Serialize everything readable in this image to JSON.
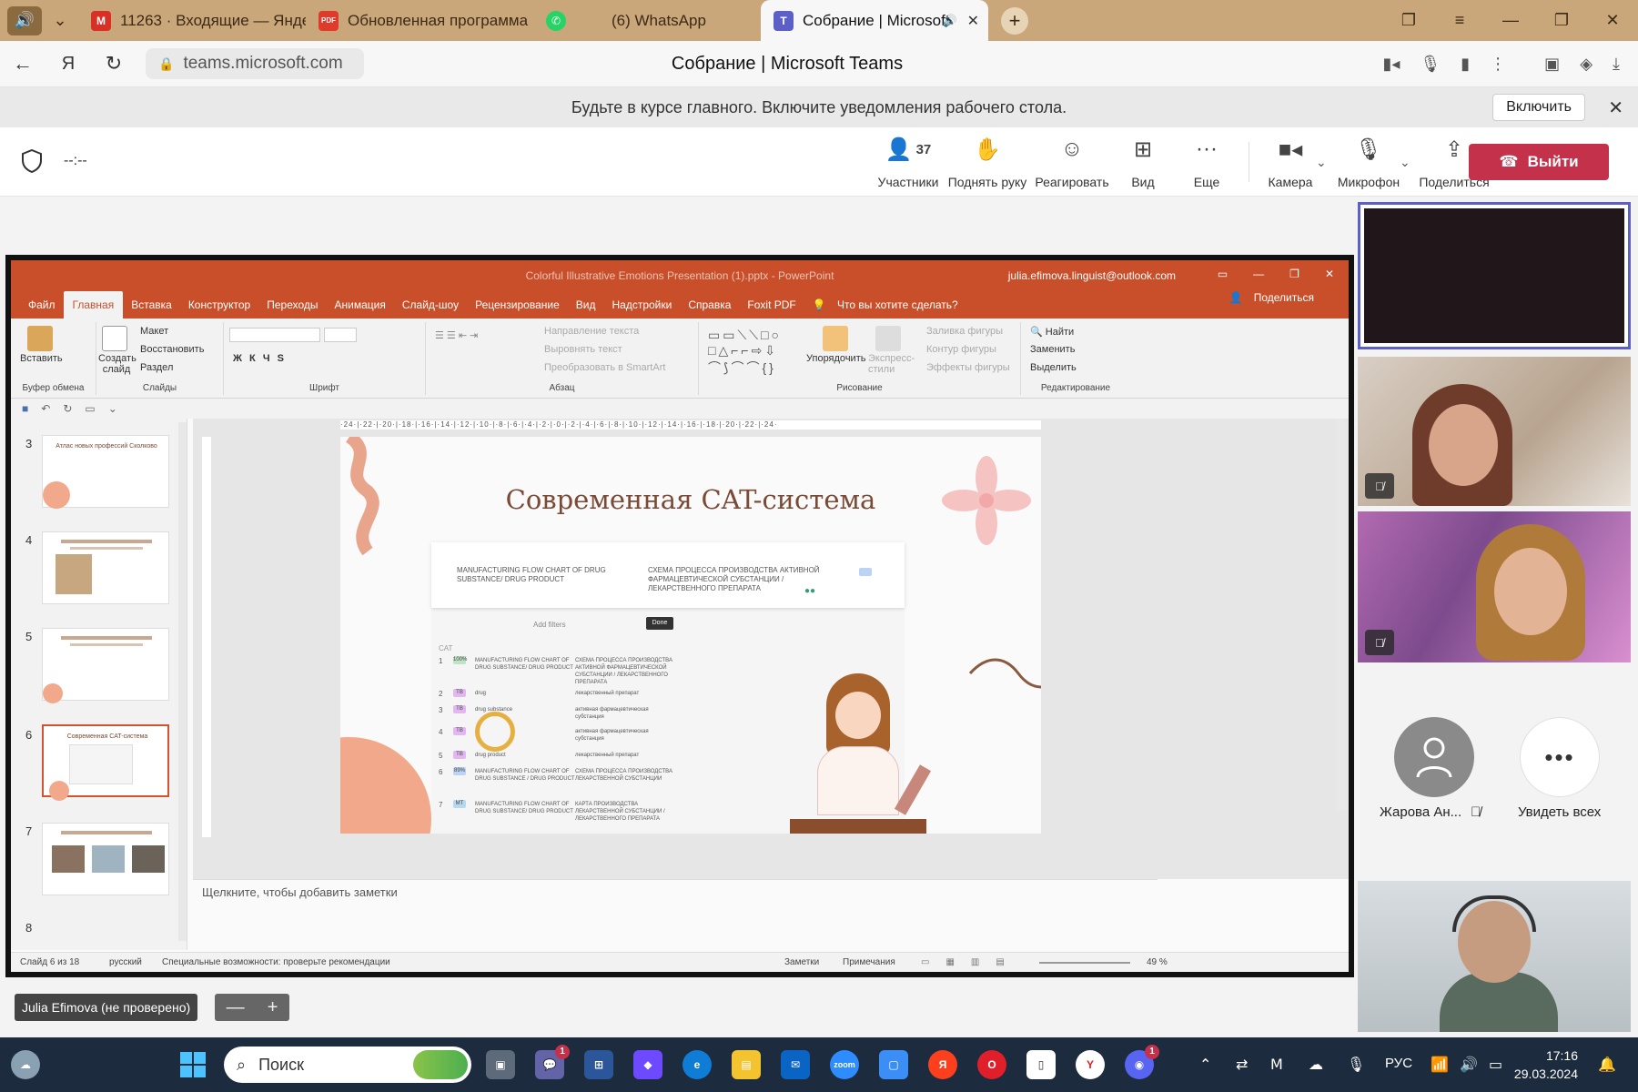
{
  "browser": {
    "tabs": [
      {
        "title": "11263 · Входящие — Янде",
        "icon": "mail-icon",
        "color": "#d93025"
      },
      {
        "title": "Обновленная программа",
        "icon": "pdf-icon",
        "color": "#e03a2b"
      },
      {
        "title": "(6) WhatsApp",
        "icon": "whatsapp-icon",
        "color": "#25d366"
      },
      {
        "title": "Собрание | Microsoft",
        "icon": "teams-icon",
        "color": "#5b5fc7",
        "active": true
      }
    ],
    "url": "teams.microsoft.com",
    "page_title": "Собрание | Microsoft Teams"
  },
  "notification": {
    "text": "Будьте в курсе главного. Включите уведомления рабочего стола.",
    "button": "Включить"
  },
  "meeting": {
    "timer": "--:--",
    "participants_count": "37",
    "tools": {
      "participants": "Участники",
      "raise_hand": "Поднять руку",
      "react": "Реагировать",
      "view": "Вид",
      "more": "Еще",
      "camera": "Камера",
      "mic": "Микрофон",
      "share": "Поделиться"
    },
    "leave": "Выйти",
    "presenter_name": "Julia Efimova (не проверено)"
  },
  "powerpoint": {
    "title": "Colorful Illustrative Emotions Presentation (1).pptx  -  PowerPoint",
    "account": "julia.efimova.linguist@outlook.com",
    "menu": [
      "Файл",
      "Главная",
      "Вставка",
      "Конструктор",
      "Переходы",
      "Анимация",
      "Слайд-шоу",
      "Рецензирование",
      "Вид",
      "Надстройки",
      "Справка",
      "Foxit PDF",
      "Что вы хотите сделать?"
    ],
    "active_menu": "Главная",
    "share": "Поделиться",
    "ribbon": {
      "paste": "Вставить",
      "clipboard": "Буфер обмена",
      "new_slide": "Создать слайд",
      "layout": "Макет",
      "reset": "Восстановить",
      "section": "Раздел",
      "slides": "Слайды",
      "font": "Шрифт",
      "text_direction": "Направление текста",
      "align_text": "Выровнять текст",
      "smartart": "Преобразовать в SmartArt",
      "paragraph": "Абзац",
      "arrange": "Упорядочить",
      "quick_styles": "Экспресс-стили",
      "shape_fill": "Заливка фигуры",
      "shape_outline": "Контур фигуры",
      "shape_effects": "Эффекты фигуры",
      "drawing": "Рисование",
      "find": "Найти",
      "replace": "Заменить",
      "select": "Выделить",
      "editing": "Редактирование"
    },
    "thumbnails": [
      {
        "num": "3",
        "title": "Атлас новых профессий Сколково"
      },
      {
        "num": "4",
        "title": ""
      },
      {
        "num": "5",
        "title": ""
      },
      {
        "num": "6",
        "title": "Современная CAT-система",
        "selected": true
      },
      {
        "num": "7",
        "title": ""
      },
      {
        "num": "8",
        "title": ""
      }
    ],
    "slide_title": "Современная CAT-система",
    "cat": {
      "source": "MANUFACTURING FLOW CHART OF DRUG SUBSTANCE/ DRUG PRODUCT",
      "target": "СХЕМА ПРОЦЕССА ПРОИЗВОДСТВА АКТИВНОЙ ФАРМАЦЕВТИЧЕСКОЙ СУБСТАНЦИИ / ЛЕКАРСТВЕННОГО ПРЕПАРАТА",
      "add_filters": "Add filters",
      "done": "Done",
      "cat_label": "CAT",
      "rows": [
        {
          "tag": "100%",
          "src": "MANUFACTURING FLOW CHART OF DRUG SUBSTANCE/ DRUG PRODUCT",
          "tgt": "СХЕМА ПРОЦЕССА ПРОИЗВОДСТВА АКТИВНОЙ ФАРМАЦЕВТИЧЕСКОЙ СУБСТАНЦИИ / ЛЕКАРСТВЕННОГО ПРЕПАРАТА"
        },
        {
          "tag": "TB",
          "src": "drug",
          "tgt": "лекарственный препарат"
        },
        {
          "tag": "TB",
          "src": "drug substance",
          "tgt": "активная фармацевтическая субстанция"
        },
        {
          "tag": "TB",
          "src": "",
          "tgt": "активная фармацевтическая субстанция"
        },
        {
          "tag": "TB",
          "src": "drug product",
          "tgt": "лекарственный препарат"
        },
        {
          "tag": "89%",
          "src": "MANUFACTURING FLOW CHART OF DRUG SUBSTANCE / DRUG PRODUCT",
          "tgt": "СХЕМА ПРОЦЕССА ПРОИЗВОДСТВА ЛЕКАРСТВЕННОЙ СУБСТАНЦИИ"
        },
        {
          "tag": "MT",
          "src": "MANUFACTURING FLOW CHART OF DRUG SUBSTANCE/ DRUG PRODUCT",
          "tgt": "КАРТА ПРОИЗВОДСТВА ЛЕКАРСТВЕННОЙ СУБСТАНЦИИ / ЛЕКАРСТВЕННОГО ПРЕПАРАТА"
        }
      ]
    },
    "notes_placeholder": "Щелкните, чтобы добавить заметки",
    "status": {
      "slide": "Слайд 6 из 18",
      "lang": "русский",
      "accessibility": "Специальные возможности: проверьте рекомендации",
      "notes": "Заметки",
      "comments": "Примечания",
      "zoom": "49 %"
    }
  },
  "participants": [
    {
      "name": "Жарова Ан...",
      "muted": true
    },
    {
      "name": "Увидеть всех"
    }
  ],
  "taskbar": {
    "search": "Поиск",
    "lang": "РУС",
    "time": "17:16",
    "date": "29.03.2024",
    "chat_badge": "1",
    "discord_badge": "1"
  }
}
